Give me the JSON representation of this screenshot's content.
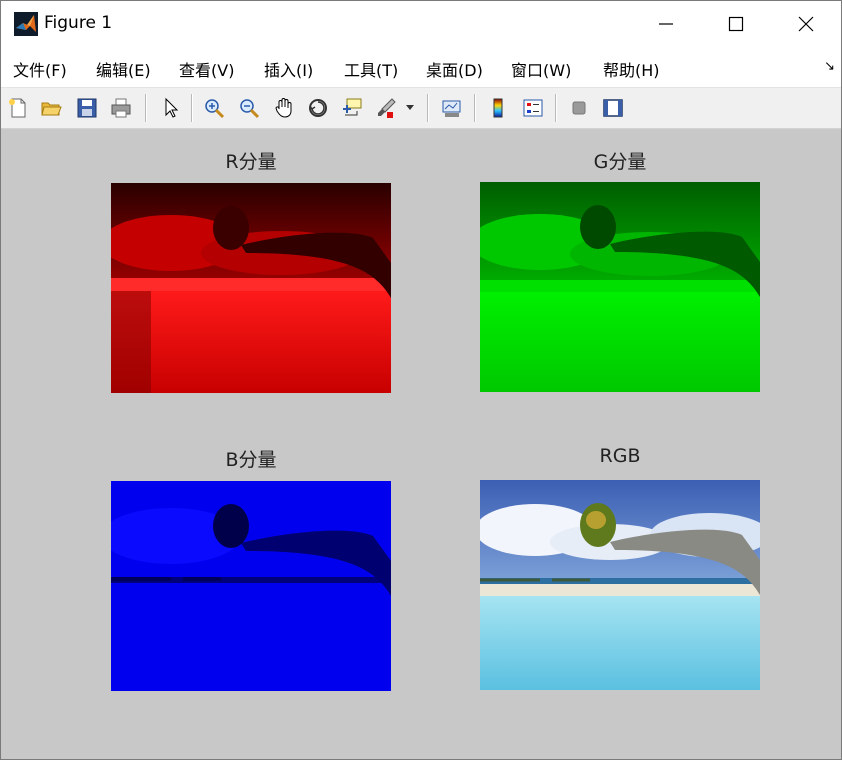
{
  "window": {
    "title": "Figure 1",
    "icon": "matlab-icon",
    "controls": [
      "minimize-icon",
      "maximize-icon",
      "close-icon"
    ]
  },
  "menubar": {
    "items": [
      {
        "label": "文件(F)"
      },
      {
        "label": "编辑(E)"
      },
      {
        "label": "查看(V)"
      },
      {
        "label": "插入(I)"
      },
      {
        "label": "工具(T)"
      },
      {
        "label": "桌面(D)"
      },
      {
        "label": "窗口(W)"
      },
      {
        "label": "帮助(H)"
      }
    ],
    "overflow_icon": "dock-arrow-icon"
  },
  "toolbar": {
    "buttons": [
      "new-figure-icon",
      "open-file-icon",
      "save-icon",
      "print-icon",
      "edit-plot-pointer-icon",
      "zoom-in-icon",
      "zoom-out-icon",
      "pan-hand-icon",
      "rotate-3d-icon",
      "data-cursor-icon",
      "brush-icon",
      "link-plot-icon",
      "colorbar-icon",
      "legend-icon",
      "hide-plot-tools-icon",
      "show-plot-tools-icon"
    ]
  },
  "figure": {
    "background": "#c8c8c8",
    "subplots": [
      {
        "title": "R分量",
        "channel": "red",
        "tint": "#e00000"
      },
      {
        "title": "G分量",
        "channel": "green",
        "tint": "#00dc00"
      },
      {
        "title": "B分量",
        "channel": "blue",
        "tint": "#0000ff"
      },
      {
        "title": "RGB",
        "channel": "rgb",
        "tint": "#7ec8e3"
      }
    ]
  }
}
